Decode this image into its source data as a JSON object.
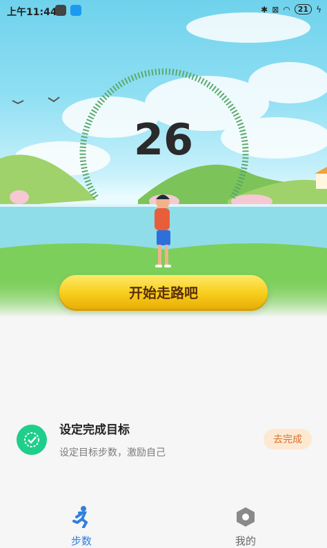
{
  "status_bar": {
    "time": "上午11:44",
    "battery": "21"
  },
  "main": {
    "step_count": "26",
    "start_button": "开始走路吧"
  },
  "goal": {
    "title": "设定完成目标",
    "subtitle": "设定目标步数，激励自己",
    "action": "去完成"
  },
  "tabs": [
    {
      "label": "步数",
      "icon": "runner-icon",
      "active": true
    },
    {
      "label": "我的",
      "icon": "hexagon-icon",
      "active": false
    }
  ],
  "colors": {
    "accent": "#2f7fdf",
    "goal_green": "#1fce8a",
    "button_yellow": "#f8cd1b"
  }
}
